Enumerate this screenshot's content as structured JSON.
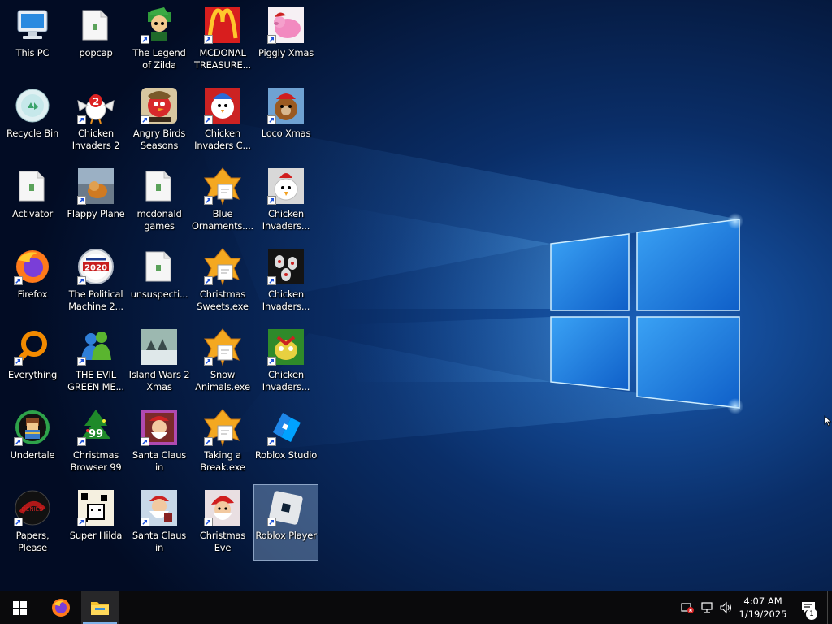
{
  "desktop": {
    "wallpaper": {
      "accent": "#2d8cf0",
      "glow": "#bfe6ff",
      "background": "#020f2a"
    },
    "icons": [
      {
        "label": "This PC",
        "icon": "this-pc-icon",
        "shortcut": false,
        "selected": false
      },
      {
        "label": "Recycle Bin",
        "icon": "recycle-bin-icon",
        "shortcut": false,
        "selected": false
      },
      {
        "label": "Activator",
        "icon": "folder-icon",
        "shortcut": false,
        "selected": false
      },
      {
        "label": "Firefox",
        "icon": "firefox-icon",
        "shortcut": true,
        "selected": false
      },
      {
        "label": "Everything",
        "icon": "everything-search-icon",
        "shortcut": true,
        "selected": false
      },
      {
        "label": "Undertale",
        "icon": "undertale-icon",
        "shortcut": true,
        "selected": false
      },
      {
        "label": "Papers, Please",
        "icon": "papers-please-icon",
        "shortcut": true,
        "selected": false
      },
      {
        "label": "popcap",
        "icon": "folder-icon",
        "shortcut": false,
        "selected": false
      },
      {
        "label": "Chicken\nInvaders 2",
        "icon": "chicken-invaders-2-icon",
        "shortcut": true,
        "selected": false
      },
      {
        "label": "Flappy Plane",
        "icon": "flappy-plane-icon",
        "shortcut": true,
        "selected": false
      },
      {
        "label": "The Political\nMachine 2...",
        "icon": "political-machine-icon",
        "shortcut": true,
        "selected": false
      },
      {
        "label": "THE EVIL\nGREEN ME...",
        "icon": "evil-green-messenger-icon",
        "shortcut": true,
        "selected": false
      },
      {
        "label": "Christmas\nBrowser 99",
        "icon": "christmas-browser-icon",
        "shortcut": true,
        "selected": false
      },
      {
        "label": "Super Hilda",
        "icon": "super-hilda-icon",
        "shortcut": true,
        "selected": false
      },
      {
        "label": "The Legend\nof Zilda",
        "icon": "legend-of-zilda-icon",
        "shortcut": true,
        "selected": false
      },
      {
        "label": "Angry Birds\nSeasons",
        "icon": "angry-birds-seasons-icon",
        "shortcut": true,
        "selected": false
      },
      {
        "label": "mcdonald\ngames",
        "icon": "folder-icon",
        "shortcut": false,
        "selected": false
      },
      {
        "label": "unsuspecti...",
        "icon": "folder-icon",
        "shortcut": false,
        "selected": false
      },
      {
        "label": "Island Wars 2\nXmas",
        "icon": "island-wars-icon",
        "shortcut": false,
        "selected": false
      },
      {
        "label": "Santa Claus in\nTrouble",
        "icon": "santa-claus-trouble-icon",
        "shortcut": true,
        "selected": false
      },
      {
        "label": "Santa Claus in\nTrouble... A...",
        "icon": "santa-claus-trouble-2-icon",
        "shortcut": true,
        "selected": false
      },
      {
        "label": "MCDONAL\nTREASURE...",
        "icon": "mcdonalds-icon",
        "shortcut": true,
        "selected": false
      },
      {
        "label": "Chicken\nInvaders C...",
        "icon": "chicken-invaders-christmas-icon",
        "shortcut": true,
        "selected": false
      },
      {
        "label": "Blue\nOrnaments....",
        "icon": "screensaver-exe-icon",
        "shortcut": true,
        "selected": false
      },
      {
        "label": "Christmas\nSweets.exe",
        "icon": "screensaver-exe-icon",
        "shortcut": true,
        "selected": false
      },
      {
        "label": "Snow\nAnimals.exe",
        "icon": "screensaver-exe-icon",
        "shortcut": true,
        "selected": false
      },
      {
        "label": "Taking a\nBreak.exe",
        "icon": "screensaver-exe-icon",
        "shortcut": true,
        "selected": false
      },
      {
        "label": "Christmas Eve\nCrisis",
        "icon": "christmas-eve-crisis-icon",
        "shortcut": true,
        "selected": false
      },
      {
        "label": "Piggly Xmas",
        "icon": "piggly-xmas-icon",
        "shortcut": true,
        "selected": false
      },
      {
        "label": "Loco Xmas",
        "icon": "loco-xmas-icon",
        "shortcut": true,
        "selected": false
      },
      {
        "label": "Chicken\nInvaders...",
        "icon": "chicken-invaders-icon",
        "shortcut": true,
        "selected": false
      },
      {
        "label": "Chicken\nInvaders...",
        "icon": "chicken-invaders-eggs-icon",
        "shortcut": true,
        "selected": false
      },
      {
        "label": "Chicken\nInvaders...",
        "icon": "chicken-invaders-green-icon",
        "shortcut": true,
        "selected": false
      },
      {
        "label": "Roblox Studio",
        "icon": "roblox-studio-icon",
        "shortcut": true,
        "selected": false
      },
      {
        "label": "Roblox Player",
        "icon": "roblox-player-icon",
        "shortcut": true,
        "selected": true
      }
    ]
  },
  "taskbar": {
    "start_icon": "windows-start-icon",
    "pinned": [
      {
        "name": "Firefox",
        "icon": "firefox-icon",
        "active": false
      },
      {
        "name": "File Explorer",
        "icon": "file-explorer-icon",
        "active": true
      }
    ],
    "tray_icons": [
      "security-warning-icon",
      "network-icon",
      "volume-icon"
    ],
    "time": "4:07 AM",
    "date": "1/19/2025",
    "notification_count": "1",
    "notification_icon": "action-center-icon"
  }
}
